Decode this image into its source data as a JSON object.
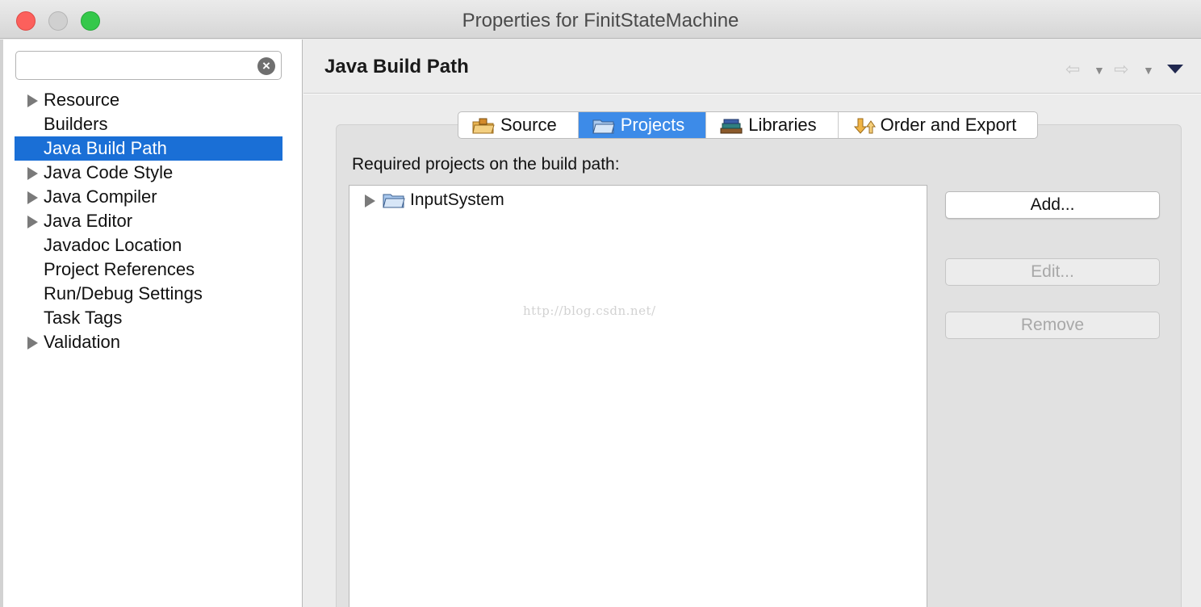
{
  "window": {
    "title": "Properties for FinitStateMachine"
  },
  "sidebar": {
    "filter_placeholder": "",
    "items": [
      {
        "label": "Resource",
        "expandable": true,
        "selected": false
      },
      {
        "label": "Builders",
        "expandable": false,
        "selected": false
      },
      {
        "label": "Java Build Path",
        "expandable": false,
        "selected": true
      },
      {
        "label": "Java Code Style",
        "expandable": true,
        "selected": false
      },
      {
        "label": "Java Compiler",
        "expandable": true,
        "selected": false
      },
      {
        "label": "Java Editor",
        "expandable": true,
        "selected": false
      },
      {
        "label": "Javadoc Location",
        "expandable": false,
        "selected": false
      },
      {
        "label": "Project References",
        "expandable": false,
        "selected": false
      },
      {
        "label": "Run/Debug Settings",
        "expandable": false,
        "selected": false
      },
      {
        "label": "Task Tags",
        "expandable": false,
        "selected": false
      },
      {
        "label": "Validation",
        "expandable": true,
        "selected": false
      }
    ]
  },
  "main": {
    "title": "Java Build Path",
    "tabs": [
      {
        "label": "Source",
        "icon": "source-folder-icon",
        "active": false
      },
      {
        "label": "Projects",
        "icon": "projects-folder-icon",
        "active": true
      },
      {
        "label": "Libraries",
        "icon": "libraries-icon",
        "active": false
      },
      {
        "label": "Order and Export",
        "icon": "order-export-icon",
        "active": false
      }
    ],
    "section_label": "Required projects on the build path:",
    "projects": [
      {
        "label": "InputSystem",
        "icon": "project-folder-icon"
      }
    ],
    "buttons": {
      "add": "Add...",
      "edit": "Edit...",
      "remove": "Remove"
    },
    "watermark": "http://blog.csdn.net/"
  },
  "colors": {
    "selection": "#1a6fd6",
    "active_tab": "#3d8be8",
    "close": "#fc605c",
    "maximize": "#34c84a"
  }
}
